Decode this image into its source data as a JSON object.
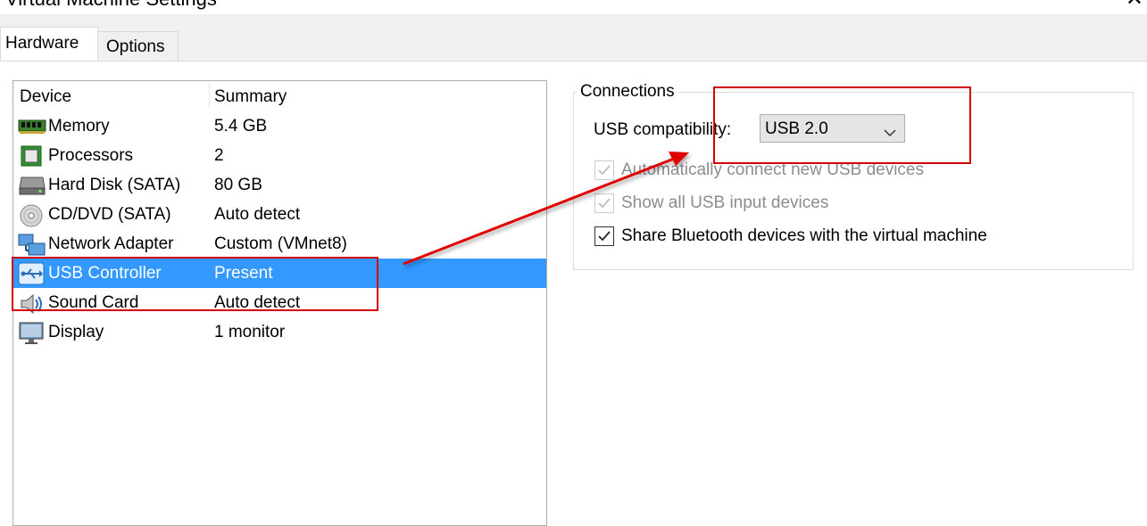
{
  "window": {
    "title": "Virtual Machine Settings",
    "close_glyph": "✕"
  },
  "tabs": [
    {
      "label": "Hardware",
      "active": true
    },
    {
      "label": "Options",
      "active": false
    }
  ],
  "device_list": {
    "columns": {
      "device": "Device",
      "summary": "Summary"
    },
    "rows": [
      {
        "icon": "memory-icon",
        "name": "Memory",
        "summary": "5.4 GB",
        "selected": false
      },
      {
        "icon": "processor-icon",
        "name": "Processors",
        "summary": "2",
        "selected": false
      },
      {
        "icon": "hard-disk-icon",
        "name": "Hard Disk (SATA)",
        "summary": "80 GB",
        "selected": false
      },
      {
        "icon": "cd-dvd-icon",
        "name": "CD/DVD (SATA)",
        "summary": "Auto detect",
        "selected": false
      },
      {
        "icon": "network-adapter-icon",
        "name": "Network Adapter",
        "summary": "Custom (VMnet8)",
        "selected": false
      },
      {
        "icon": "usb-icon",
        "name": "USB Controller",
        "summary": "Present",
        "selected": true
      },
      {
        "icon": "sound-card-icon",
        "name": "Sound Card",
        "summary": "Auto detect",
        "selected": false
      },
      {
        "icon": "display-icon",
        "name": "Display",
        "summary": "1 monitor",
        "selected": false
      }
    ]
  },
  "connections": {
    "legend": "Connections",
    "usb_compat_label": "USB compatibility:",
    "usb_compat_value": "USB 2.0",
    "checkboxes": [
      {
        "label": "Automatically connect new USB devices",
        "checked": true,
        "enabled": false
      },
      {
        "label": "Show all USB input devices",
        "checked": true,
        "enabled": false
      },
      {
        "label": "Share Bluetooth devices with the virtual machine",
        "checked": true,
        "enabled": true
      }
    ]
  },
  "colors": {
    "selection": "#3399ff",
    "annotation": "#d40000",
    "dialog_bg": "#f0f0f0"
  }
}
